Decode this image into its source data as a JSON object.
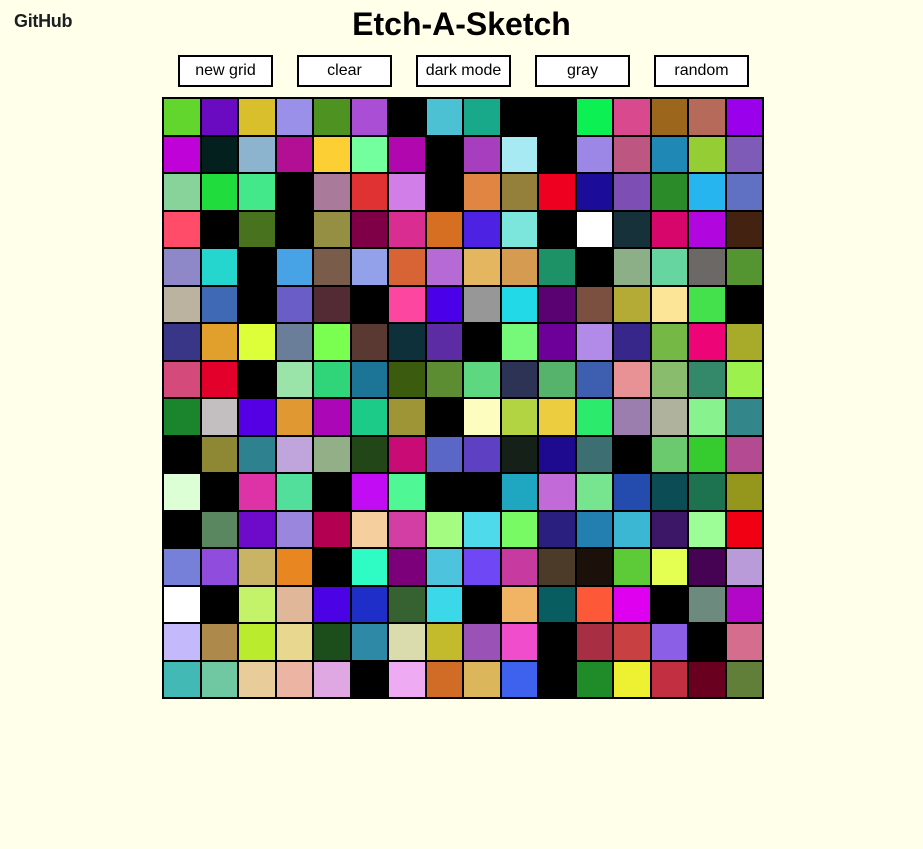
{
  "header": {
    "github_label": "GitHub",
    "title": "Etch-A-Sketch"
  },
  "toolbar": {
    "buttons": [
      "new grid",
      "clear",
      "dark mode",
      "gray",
      "random"
    ]
  },
  "grid": {
    "size": 16,
    "cells": [
      [
        "#63d62d",
        "#6a0bc1",
        "#d9bf2c",
        "#9a8fe9",
        "#4e9222",
        "#aa4fd5",
        "#000000",
        "#4bc1d3",
        "#17a98a",
        "#000000",
        "#000000",
        "#0cf053",
        "#d84a8d",
        "#9d661d",
        "#b56a5a",
        "#9a00eb"
      ],
      [
        "#bf02d8",
        "#03201f",
        "#8db4cf",
        "#b20f94",
        "#fccf34",
        "#74ff9e",
        "#b008ae",
        "#000000",
        "#a63ebd",
        "#a8eaf4",
        "#000000",
        "#9c86e6",
        "#bd5782",
        "#1f88b5",
        "#95ce34",
        "#7d5bb6"
      ],
      [
        "#88d39a",
        "#20dc3c",
        "#42e889",
        "#000000",
        "#aa7a9a",
        "#e03232",
        "#d27ee9",
        "#000000",
        "#e08642",
        "#94803a",
        "#ee0020",
        "#1b0c99",
        "#7d4eb4",
        "#2c8b29",
        "#26b5ee",
        "#6070c2"
      ],
      [
        "#ff4d69",
        "#000000",
        "#48721e",
        "#000000",
        "#958f43",
        "#7f0046",
        "#da2d92",
        "#d66f22",
        "#4e22e2",
        "#7de6dc",
        "#000000",
        "#ffffff",
        "#17313b",
        "#d6066b",
        "#b106dd",
        "#432211"
      ],
      [
        "#8e88c9",
        "#24d6cd",
        "#000000",
        "#47a3e6",
        "#7a5c4a",
        "#92a1ea",
        "#d86334",
        "#b56ad6",
        "#e3b65f",
        "#d59c51",
        "#1c9266",
        "#000000",
        "#8daf88",
        "#67d5a0",
        "#6c6866",
        "#549532"
      ],
      [
        "#bbb39f",
        "#3f69b5",
        "#000000",
        "#6a5dc8",
        "#532b35",
        "#000000",
        "#fd469f",
        "#4a00e8",
        "#989797",
        "#22d9e8",
        "#5a0271",
        "#7c5040",
        "#b3ab35",
        "#fde598",
        "#44e14d",
        "#000000"
      ],
      [
        "#393688",
        "#e1a02b",
        "#ddff3a",
        "#6b7e99",
        "#7aff51",
        "#5b3933",
        "#0e303a",
        "#5b2ca4",
        "#000000",
        "#76f879",
        "#6e009a",
        "#b18be7",
        "#38278a",
        "#76b846",
        "#ed0578",
        "#a7ab29"
      ],
      [
        "#d44b7b",
        "#e3002a",
        "#000000",
        "#9ae3a9",
        "#30d57a",
        "#1c7597",
        "#3b5c0f",
        "#5c8d32",
        "#5dd880",
        "#2c3354",
        "#56b36c",
        "#3e5eb0",
        "#e89296",
        "#8abc6d",
        "#33896a",
        "#9df14c"
      ],
      [
        "#1b852e",
        "#c3bfc1",
        "#5500e4",
        "#e09832",
        "#ac07b6",
        "#1ccb88",
        "#9e9537",
        "#000000",
        "#fdfdc0",
        "#b2d443",
        "#eccd40",
        "#2cea6c",
        "#9b7ead",
        "#afb29c",
        "#88f38e",
        "#33868a"
      ],
      [
        "#000000",
        "#8e8835",
        "#2e8290",
        "#c0a4dc",
        "#93af88",
        "#224617",
        "#c90c75",
        "#5a67c7",
        "#5e41c3",
        "#152018",
        "#1d0a8e",
        "#3d6e71",
        "#000000",
        "#6bca6e",
        "#36cb2e",
        "#b44a91"
      ],
      [
        "#ddffd6",
        "#000000",
        "#dd33a7",
        "#52df9b",
        "#000000",
        "#c20cf4",
        "#4ff894",
        "#000000",
        "#000000",
        "#1fa7c2",
        "#c36ad9",
        "#77e490",
        "#244bae",
        "#0c4c55",
        "#1d7350",
        "#95961c"
      ],
      [
        "#000000",
        "#5a8660",
        "#6e0bcb",
        "#9b86de",
        "#b30051",
        "#f6cf9e",
        "#d33ea4",
        "#a4fd80",
        "#4fdaec",
        "#78fa65",
        "#2a1e7e",
        "#227fb0",
        "#3bb7d4",
        "#3c1667",
        "#9dfe97",
        "#f00012"
      ],
      [
        "#7780d9",
        "#8f4cdd",
        "#c9b466",
        "#e88721",
        "#000000",
        "#2ffcc4",
        "#7b0079",
        "#4dc3de",
        "#7047f5",
        "#c73ba1",
        "#4c3b29",
        "#1c110a",
        "#5dcb38",
        "#e4fe52",
        "#460353",
        "#b99bd9"
      ],
      [
        "#ffffff",
        "#000000",
        "#c4f36a",
        "#e0b899",
        "#4b02e5",
        "#1f2dc9",
        "#356230",
        "#3bd8e9",
        "#000000",
        "#f0b464",
        "#085d61",
        "#fd5838",
        "#df00ef",
        "#000000",
        "#6c8a7e",
        "#b207c8"
      ],
      [
        "#c4b9fb",
        "#ad8a4c",
        "#baec2d",
        "#e8d88f",
        "#1c4e1c",
        "#2e89a7",
        "#dbdcae",
        "#c4bb2c",
        "#9a52b6",
        "#ef4dcb",
        "#000000",
        "#a82e44",
        "#c94042",
        "#8b60e6",
        "#000000",
        "#d56d8e"
      ],
      [
        "#43b9b6",
        "#6fc8a1",
        "#e8cc9a",
        "#ecb5a3",
        "#e0a8e2",
        "#000000",
        "#eeabf3",
        "#d16c26",
        "#dbb65b",
        "#3e62ed",
        "#000000",
        "#1f8b29",
        "#eef032",
        "#c12f41",
        "#6a0020",
        "#617f38"
      ]
    ]
  }
}
